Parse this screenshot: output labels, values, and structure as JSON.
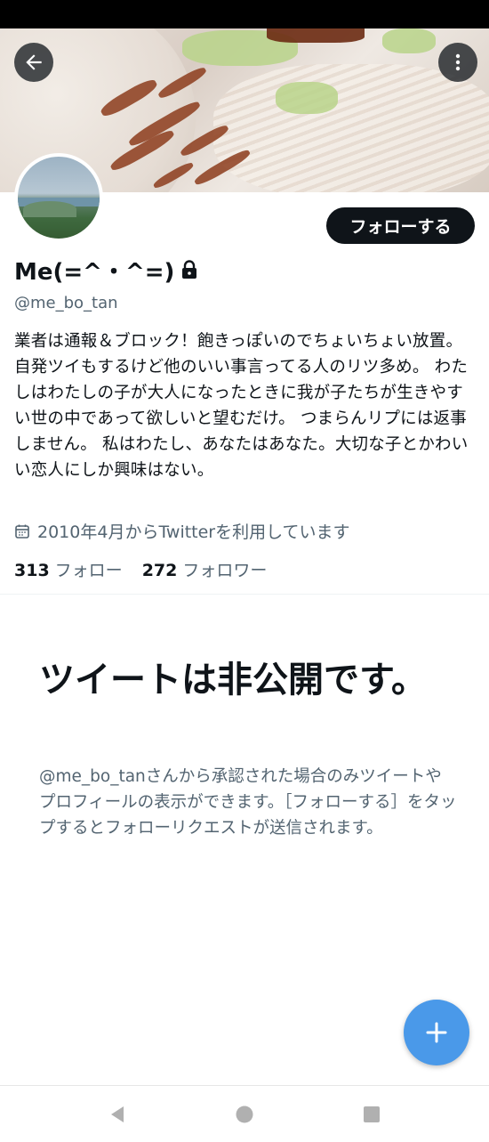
{
  "profile": {
    "display_name": "Me(=^・^=)",
    "handle": "@me_bo_tan",
    "bio": "業者は通報＆ブロック！飽きっぽいのでちょいちょい放置。自発ツイもするけど他のいい事言ってる人のリツ多め。 わたしはわたしの子が大人になったときに我が子たちが生きやすい世の中であって欲しいと望むだけ。 つまらんリプには返事しません。 私はわたし、あなたはあなた。大切な子とかわいい恋人にしか興味はない。",
    "joined": "2010年4月からTwitterを利用しています",
    "following_count": "313",
    "following_label": "フォロー",
    "followers_count": "272",
    "followers_label": "フォロワー"
  },
  "actions": {
    "follow_label": "フォローする"
  },
  "private_notice": {
    "title": "ツイートは非公開です。",
    "description": "@me_bo_tanさんから承認された場合のみツイートやプロフィールの表示ができます。［フォローする］をタップするとフォローリクエストが送信されます。"
  },
  "icons": {
    "back": "arrow-left-icon",
    "more": "more-vertical-icon",
    "lock": "lock-icon",
    "calendar": "calendar-icon",
    "compose": "plus-icon",
    "nav_back": "triangle-back-icon",
    "nav_home": "circle-home-icon",
    "nav_recents": "square-recents-icon"
  },
  "colors": {
    "accent": "#4a99e9",
    "text_primary": "#0f1419",
    "text_secondary": "#536471",
    "follow_button": "#0f1419"
  }
}
